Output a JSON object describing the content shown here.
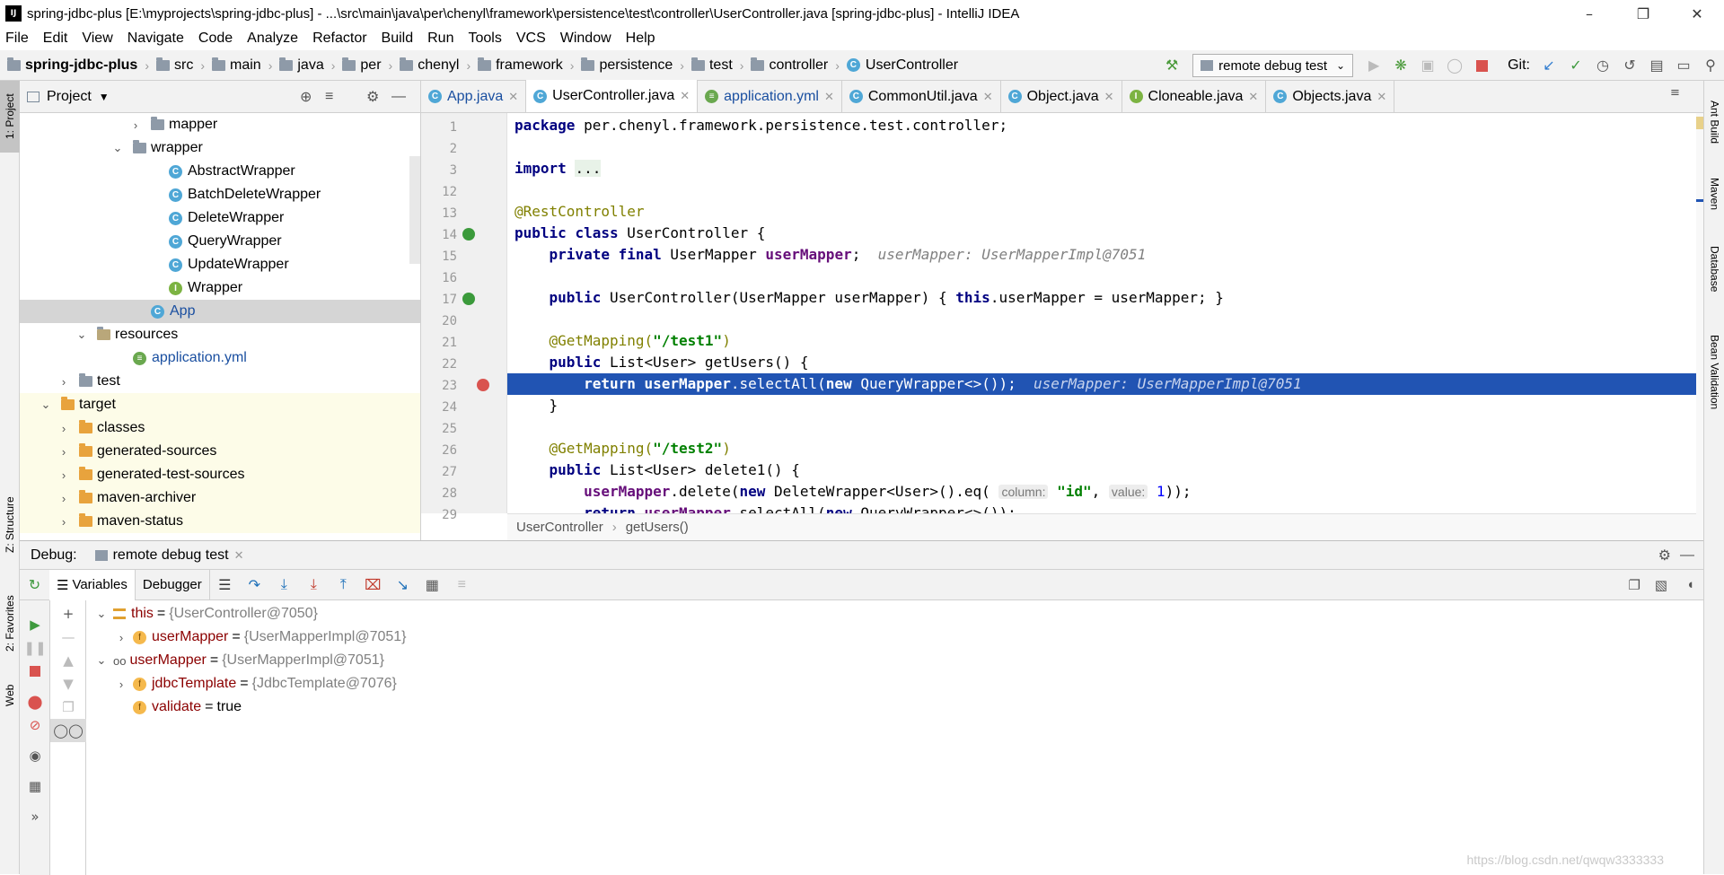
{
  "window": {
    "title": "spring-jdbc-plus [E:\\myprojects\\spring-jdbc-plus] - ...\\src\\main\\java\\per\\chenyl\\framework\\persistence\\test\\controller\\UserController.java [spring-jdbc-plus] - IntelliJ IDEA",
    "icon_label": "IJ"
  },
  "menu": [
    "File",
    "Edit",
    "View",
    "Navigate",
    "Code",
    "Analyze",
    "Refactor",
    "Build",
    "Run",
    "Tools",
    "VCS",
    "Window",
    "Help"
  ],
  "navbar": {
    "crumbs": [
      "spring-jdbc-plus",
      "src",
      "main",
      "java",
      "per",
      "chenyl",
      "framework",
      "persistence",
      "test",
      "controller",
      "UserController"
    ],
    "run_config": "remote debug test",
    "git_label": "Git:"
  },
  "side_tabs": {
    "left": [
      "1: Project",
      "Z: Structure",
      "2: Favorites",
      "Web"
    ],
    "right": [
      "Ant Build",
      "Maven",
      "Database",
      "Bean Validation"
    ]
  },
  "project": {
    "header": "Project",
    "rows": [
      {
        "label": "mapper",
        "type": "pkg",
        "depth": 6,
        "arrow": "›"
      },
      {
        "label": "wrapper",
        "type": "pkg",
        "depth": 5,
        "arrow": "⌄"
      },
      {
        "label": "AbstractWrapper",
        "type": "class",
        "depth": 7
      },
      {
        "label": "BatchDeleteWrapper",
        "type": "class",
        "depth": 7
      },
      {
        "label": "DeleteWrapper",
        "type": "class",
        "depth": 7
      },
      {
        "label": "QueryWrapper",
        "type": "class",
        "depth": 7
      },
      {
        "label": "UpdateWrapper",
        "type": "class",
        "depth": 7
      },
      {
        "label": "Wrapper",
        "type": "iface",
        "depth": 7
      },
      {
        "label": "App",
        "type": "class",
        "depth": 6,
        "selected": true
      },
      {
        "label": "resources",
        "type": "res",
        "depth": 3,
        "arrow": "⌄"
      },
      {
        "label": "application.yml",
        "type": "yml",
        "depth": 5
      },
      {
        "label": "test",
        "type": "folder",
        "depth": 2,
        "arrow": "›"
      },
      {
        "label": "target",
        "type": "orange",
        "depth": 1,
        "arrow": "⌄",
        "excluded": true
      },
      {
        "label": "classes",
        "type": "orange",
        "depth": 2,
        "arrow": "›",
        "excluded": true
      },
      {
        "label": "generated-sources",
        "type": "orange",
        "depth": 2,
        "arrow": "›",
        "excluded": true
      },
      {
        "label": "generated-test-sources",
        "type": "orange",
        "depth": 2,
        "arrow": "›",
        "excluded": true
      },
      {
        "label": "maven-archiver",
        "type": "orange",
        "depth": 2,
        "arrow": "›",
        "excluded": true
      },
      {
        "label": "maven-status",
        "type": "orange",
        "depth": 2,
        "arrow": "›",
        "excluded": true
      }
    ]
  },
  "editor_tabs": [
    {
      "label": "App.java",
      "icon": "class"
    },
    {
      "label": "UserController.java",
      "icon": "class",
      "active": true
    },
    {
      "label": "application.yml",
      "icon": "yml"
    },
    {
      "label": "CommonUtil.java",
      "icon": "class"
    },
    {
      "label": "Object.java",
      "icon": "class"
    },
    {
      "label": "Cloneable.java",
      "icon": "iface"
    },
    {
      "label": "Objects.java",
      "icon": "class"
    }
  ],
  "code": {
    "line_numbers": [
      "1",
      "2",
      "3",
      "12",
      "13",
      "14",
      "15",
      "16",
      "17",
      "20",
      "21",
      "22",
      "23",
      "24",
      "25",
      "26",
      "27",
      "28",
      "29"
    ],
    "t": {
      "package": "package",
      "pkg_name": " per.chenyl.framework.persistence.test.controller;",
      "import": "import",
      "import_fold": "...",
      "rest_ann": "@RestController",
      "public": "public",
      "class": "class",
      "class_name": " UserController {",
      "private": "private",
      "final": "final",
      "user_mapper_type": " UserMapper ",
      "user_mapper_field": "userMapper",
      "semi": ";",
      "hint1": "userMapper: UserMapperImpl@7051",
      "ctor_sig": " UserController(UserMapper userMapper) { ",
      "this": "this",
      "ctor_body": ".userMapper = userMapper; }",
      "getmapping": "@GetMapping(",
      "test1": "\"/test1\"",
      "close_paren": ")",
      "list_sig1": " List<User> getUsers() {",
      "return": "return",
      "select_all": ".selectAll(",
      "new": "new",
      "query_wrapper": " QueryWrapper<>());",
      "hint2": "userMapper: UserMapperImpl@7051",
      "close_brace": "}",
      "test2": "\"/test2\"",
      "list_sig2": " List<User> delete1() {",
      "delete_call": ".delete(",
      "delete_wrapper": " DeleteWrapper<User>().eq(",
      "column_hint": "column:",
      "id_str": "\"id\"",
      "comma": ", ",
      "value_hint": "value:",
      "one": "1",
      "end_paren": "));"
    }
  },
  "editor_breadcrumb": [
    "UserController",
    "getUsers()"
  ],
  "debug": {
    "label": "Debug:",
    "session": "remote debug test",
    "tabs": [
      "Variables",
      "Debugger"
    ],
    "vars": [
      {
        "indent": 0,
        "arrow": "⌄",
        "icon": "this",
        "name": "this",
        "value": "{UserController@7050}",
        "name_color": "#8b0000"
      },
      {
        "indent": 1,
        "arrow": "›",
        "icon": "f",
        "name": "userMapper",
        "value": "{UserMapperImpl@7051}",
        "name_color": "#8b0000"
      },
      {
        "indent": 0,
        "arrow": "⌄",
        "icon": "watch",
        "name": "userMapper",
        "value": "{UserMapperImpl@7051}",
        "name_color": "#8b0000"
      },
      {
        "indent": 1,
        "arrow": "›",
        "icon": "f",
        "name": "jdbcTemplate",
        "value": "{JdbcTemplate@7076}",
        "name_color": "#8b0000"
      },
      {
        "indent": 1,
        "arrow": "",
        "icon": "f",
        "name": "validate",
        "value": "true",
        "name_color": "#8b0000",
        "value_color": "#000000"
      }
    ]
  },
  "watermark": "https://blog.csdn.net/qwqw3333333",
  "colors": {
    "accent": "#2154b3",
    "selection": "#d5d5d5"
  }
}
